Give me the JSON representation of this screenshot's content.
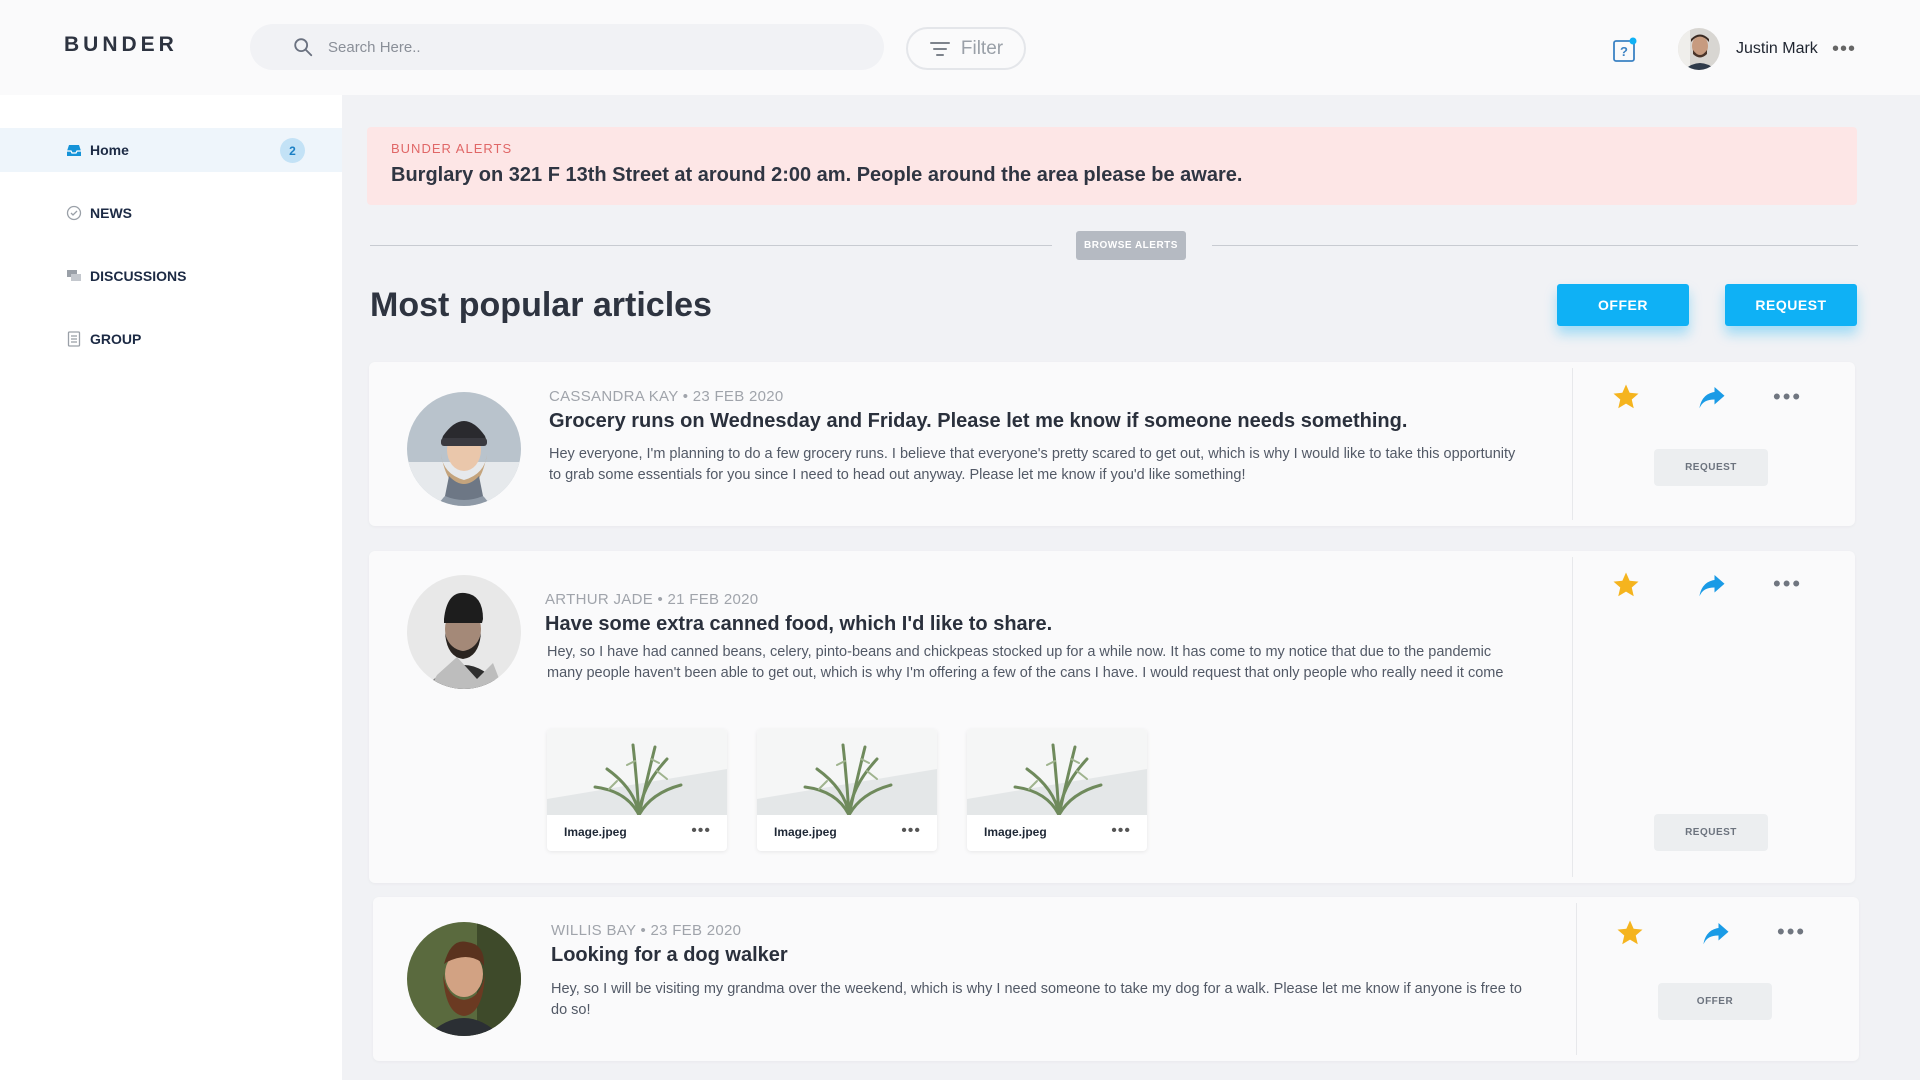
{
  "app": {
    "logo": "BUNDER"
  },
  "header": {
    "search_placeholder": "Search Here..",
    "filter_label": "Filter",
    "user_name": "Justin Mark",
    "more": "•••"
  },
  "sidebar": {
    "items": [
      {
        "label": "Home",
        "badge": "2",
        "active": true,
        "icon": "inbox-icon"
      },
      {
        "label": "NEWS",
        "icon": "check-circle-icon"
      },
      {
        "label": "DISCUSSIONS",
        "icon": "chat-icon"
      },
      {
        "label": "GROUP",
        "icon": "document-icon"
      }
    ]
  },
  "alert": {
    "label": "BUNDER ALERTS",
    "text": "Burglary on 321 F 13th Street at around 2:00 am. People around the area please be aware."
  },
  "browse_alerts": "BROWSE ALERTS",
  "section": {
    "title": "Most popular articles",
    "offer_label": "OFFER",
    "request_label": "REQUEST"
  },
  "articles": [
    {
      "author": "CASSANDRA KAY",
      "date": "23 FEB 2020",
      "meta": "CASSANDRA KAY • 23 FEB 2020",
      "title": "Grocery runs on Wednesday and Friday. Please let me know if someone needs something.",
      "body": "Hey everyone, I'm planning to do a few grocery runs. I believe that everyone's pretty scared to get out, which is why I would like to take this opportunity to grab some essentials for you since I need to head out anyway. Please let me know if you'd like something!",
      "action_label": "REQUEST",
      "more": "•••"
    },
    {
      "author": "ARTHUR JADE",
      "date": "21 FEB 2020",
      "meta": "ARTHUR JADE • 21 FEB 2020",
      "title": "Have some extra canned food, which I'd like to share.",
      "body": "Hey, so I have had canned beans, celery, pinto-beans and chickpeas stocked up for a while now. It has come to my notice that due to the pandemic many people haven't been able to get out, which is why I'm offering a few of the cans I have. I would request that only people who really need it come",
      "action_label": "REQUEST",
      "more": "•••",
      "attachments": [
        {
          "name": "Image.jpeg",
          "more": "•••"
        },
        {
          "name": "Image.jpeg",
          "more": "•••"
        },
        {
          "name": "Image.jpeg",
          "more": "•••"
        }
      ]
    },
    {
      "author": "WILLIS BAY",
      "date": "23 FEB 2020",
      "meta": "WILLIS BAY • 23 FEB 2020",
      "title": "Looking for a dog walker",
      "body": "Hey, so I will be visiting my grandma over the weekend, which is why I need someone to take my dog for a walk. Please let me know if anyone is free to do so!",
      "action_label": "OFFER",
      "more": "•••"
    }
  ],
  "colors": {
    "accent": "#0fb1f5",
    "star": "#f5b41e",
    "alert_bg": "#fde6e6",
    "alert_label": "#e06767",
    "badge_bg": "#c3e2f6"
  }
}
